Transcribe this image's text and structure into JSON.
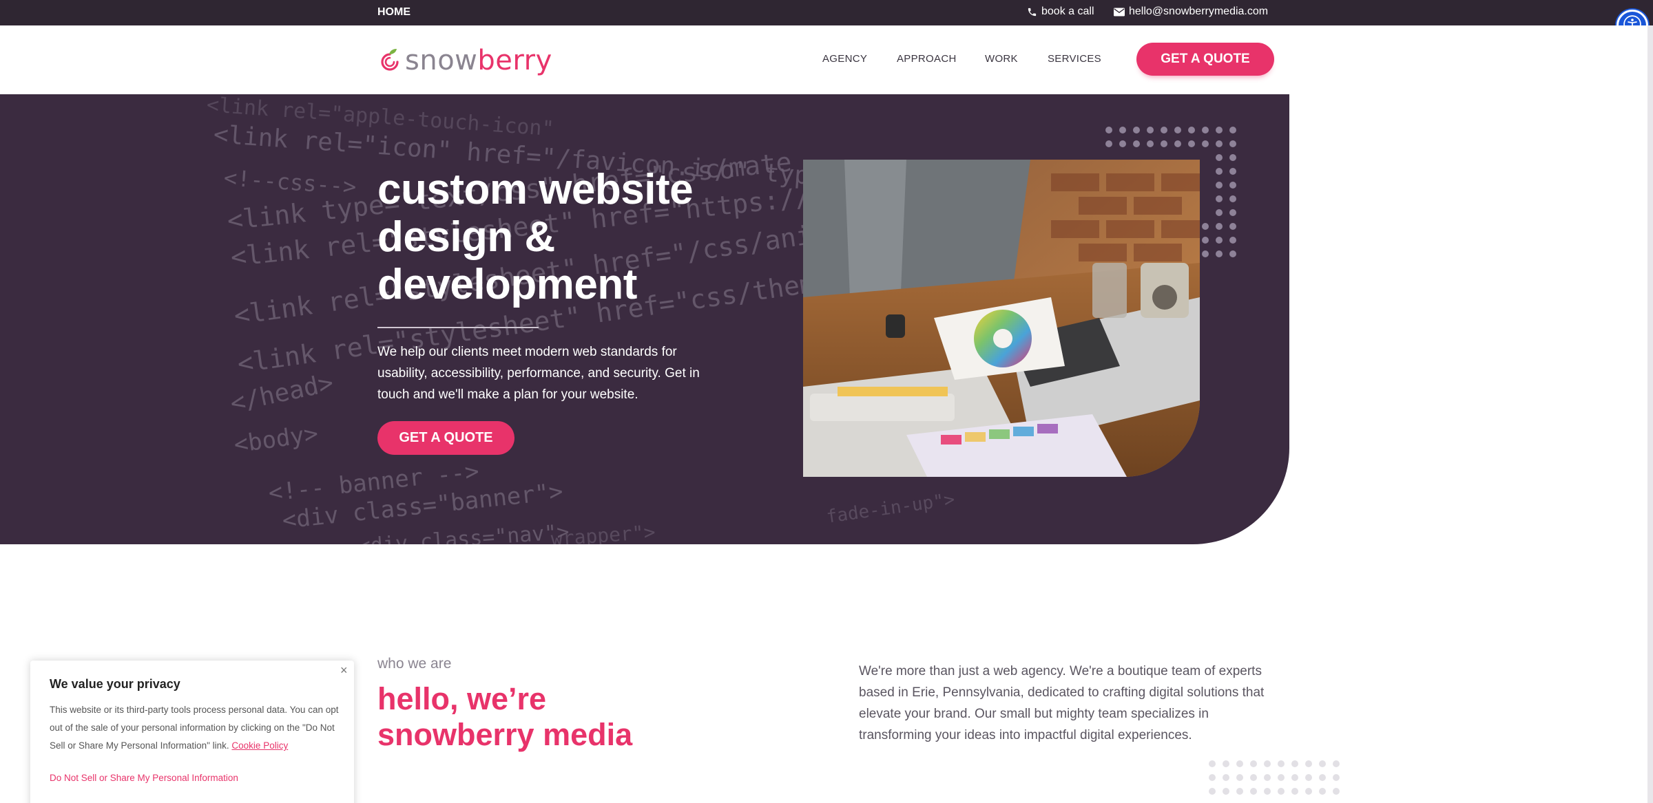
{
  "topbar": {
    "home": "HOME",
    "call_label": "book a call",
    "email_label": "hello@snowberrymedia.com"
  },
  "header": {
    "logo_part1": "snow",
    "logo_part2": "berry",
    "nav": [
      "AGENCY",
      "APPROACH",
      "WORK",
      "SERVICES"
    ],
    "cta": "GET A QUOTE"
  },
  "hero": {
    "title": "custom website design & development",
    "subtitle": "We help our clients meet modern web standards for usability, accessibility, performance, and security. Get in touch and we'll make a plan for your website.",
    "cta": "GET A QUOTE",
    "code_lines": [
      "<link rel=\"icon\" href=\"/favicon.ico\" type=\"image/x-icon\">",
      "<!--css-->",
      "<link type=\"text/css\" href=\"css/mate",
      "<link rel=\"stylesheet\" href=\"https://maxcdn.bootstra",
      "<link rel=\"stylesheet\" href=\"/css/animate.css\">",
      "<link rel=\"stylesheet\" href=\"css/theme.css\">",
      "</head>",
      "<body>",
      "<!-- banner -->",
      "<div class=\"banner\">",
      "<div class=\"nav\">",
      "<link rel=\"apple-touch-icon\"",
      "wrapper\">",
      "fade-in-up\">"
    ]
  },
  "about": {
    "eyebrow": "who we are",
    "title": "hello, we’re snowberry media",
    "body": "We're more than just a web agency. We're a boutique team of experts based in Erie, Pennsylvania, dedicated to crafting digital solutions that elevate your brand. Our small but mighty team specializes in transforming your ideas into impactful digital experiences."
  },
  "cookie": {
    "title": "We value your privacy",
    "text": "This website or its third-party tools process personal data. You can opt out of the sale of your personal information by clicking on the \"Do Not Sell or Share My Personal Information\" link.",
    "policy_link": "Cookie Policy",
    "dns_link": "Do Not Sell or Share My Personal Information",
    "close": "×"
  },
  "colors": {
    "brand_pink": "#e8336a",
    "hero_purple": "#3b2b40",
    "topbar": "#2f2632",
    "a11y_blue": "#1a56d8"
  },
  "icons": [
    "phone-icon",
    "envelope-icon",
    "accessibility-icon",
    "snowberry-logo-icon",
    "close-icon"
  ]
}
